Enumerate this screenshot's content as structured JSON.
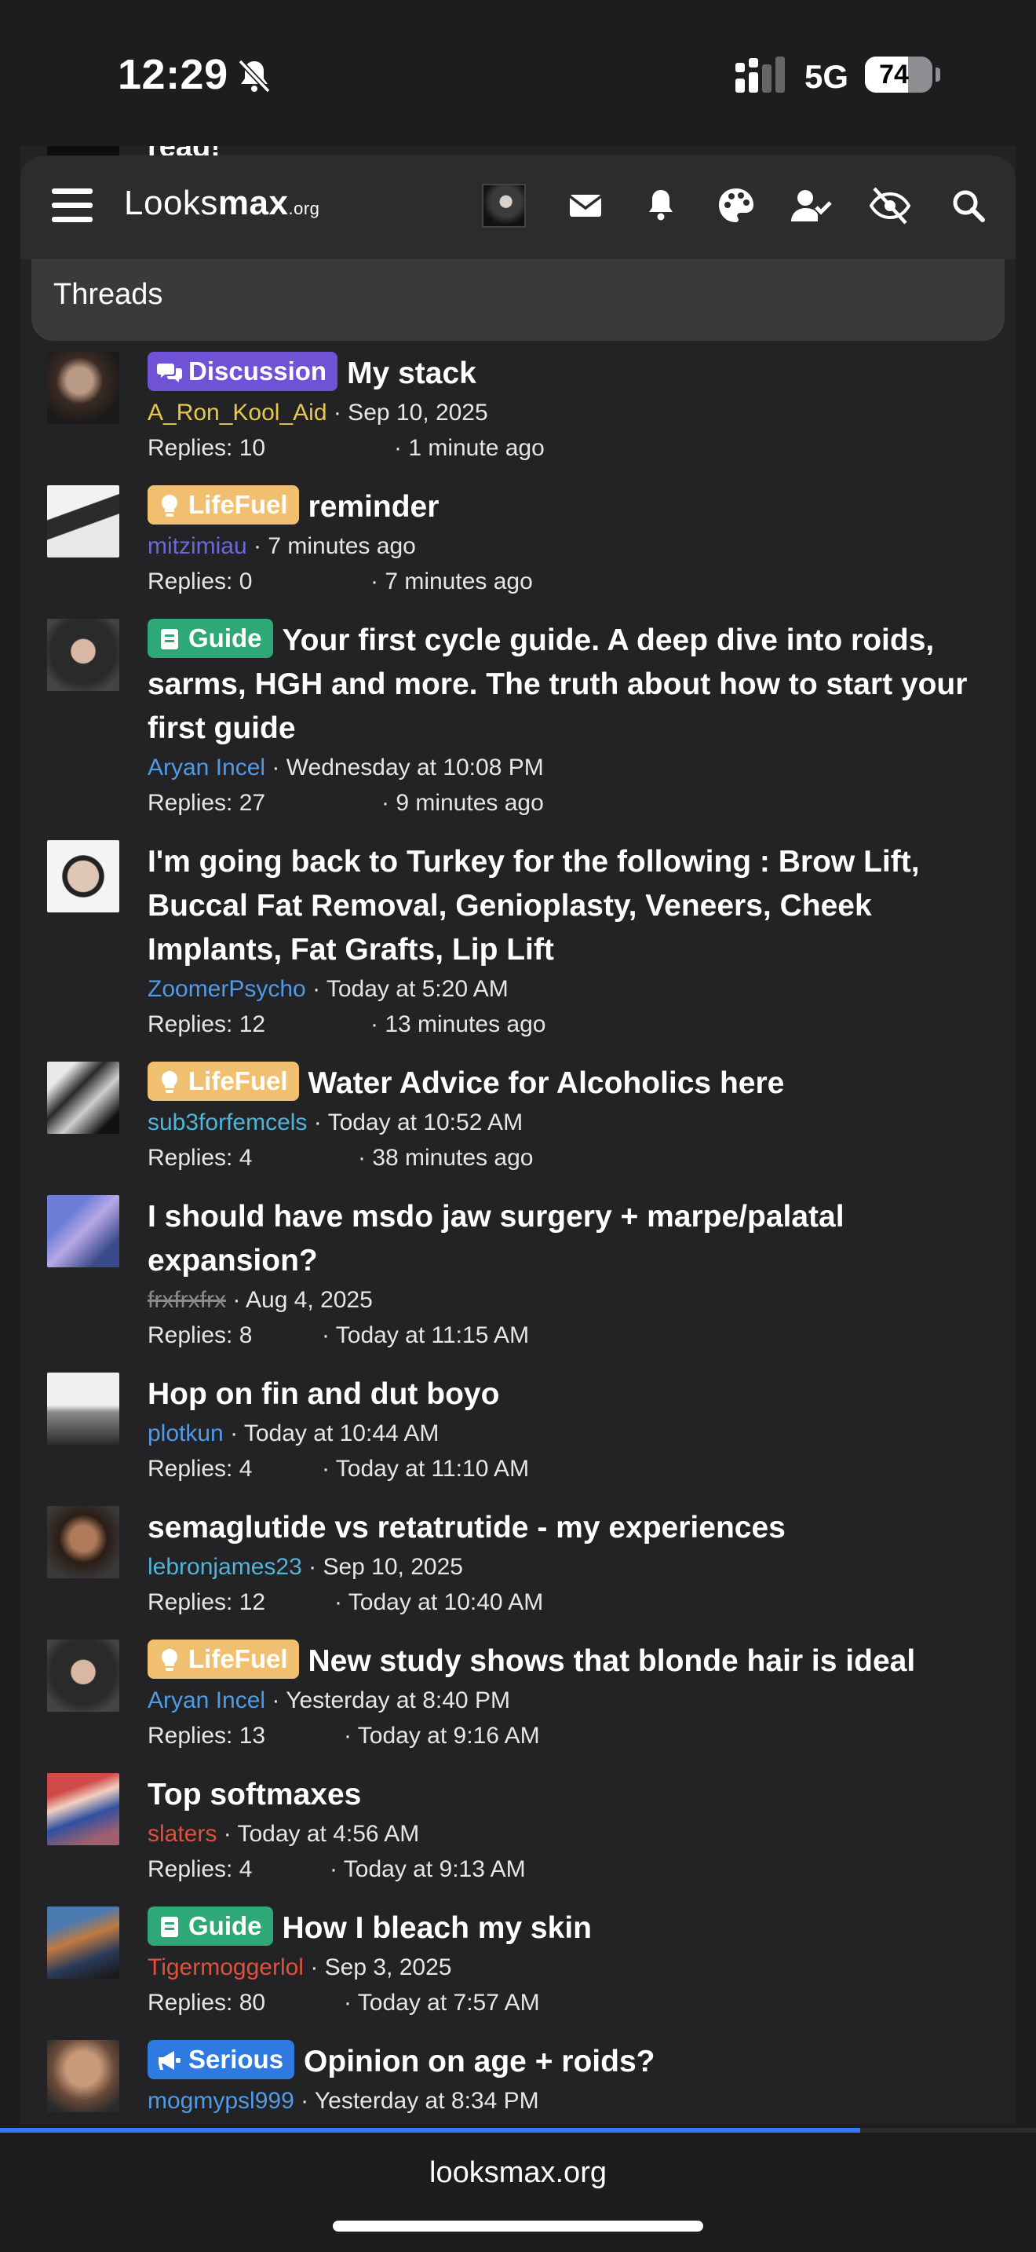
{
  "status": {
    "time": "12:29",
    "network": "5G",
    "battery": "74",
    "battery_level": 0.74
  },
  "fragment": {
    "text": "read!"
  },
  "nav": {
    "logo_main": "Looks",
    "logo_bold": "max",
    "logo_tld": ".org"
  },
  "section_title": "Threads",
  "threads": [
    {
      "badge": "Discussion",
      "title": "My stack",
      "author": "A_Ron_Kool_Aid",
      "date": "· Sep 10, 2025",
      "replies": "Replies: 10",
      "last": "· 1 minute ago"
    },
    {
      "badge": "LifeFuel",
      "title": "reminder",
      "author": "mitzimiau",
      "date": "· 7 minutes ago",
      "replies": "Replies: 0",
      "last": "· 7 minutes ago"
    },
    {
      "badge": "Guide",
      "title": "Your first cycle guide. A deep dive into roids, sarms, HGH and more. The truth about how to start your first guide",
      "author": "Aryan Incel",
      "date": "· Wednesday at 10:08 PM",
      "replies": "Replies: 27",
      "last": "· 9 minutes ago"
    },
    {
      "badge": "",
      "title": "I'm going back to Turkey for the following : Brow Lift, Buccal Fat Removal, Genioplasty, Veneers, Cheek Implants, Fat Grafts, Lip Lift",
      "author": "ZoomerPsycho",
      "date": "· Today at 5:20 AM",
      "replies": "Replies: 12",
      "last": "· 13 minutes ago"
    },
    {
      "badge": "LifeFuel",
      "title": "Water Advice for Alcoholics here",
      "author": "sub3forfemcels",
      "date": "· Today at 10:52 AM",
      "replies": "Replies: 4",
      "last": "· 38 minutes ago"
    },
    {
      "badge": "",
      "title": "I should have msdo jaw surgery + marpe/palatal expansion?",
      "author": "frxfrxfrx",
      "date": "· Aug 4, 2025",
      "replies": "Replies: 8",
      "last": "· Today at 11:15 AM"
    },
    {
      "badge": "",
      "title": "Hop on fin and dut boyo",
      "author": "plotkun",
      "date": "· Today at 10:44 AM",
      "replies": "Replies: 4",
      "last": "· Today at 11:10 AM"
    },
    {
      "badge": "",
      "title": "semaglutide vs retatrutide - my experiences",
      "author": "lebronjames23",
      "date": "· Sep 10, 2025",
      "replies": "Replies: 12",
      "last": "· Today at 10:40 AM"
    },
    {
      "badge": "LifeFuel",
      "title": "New study shows that blonde hair is ideal",
      "author": "Aryan Incel",
      "date": "· Yesterday at 8:40 PM",
      "replies": "Replies: 13",
      "last": "· Today at 9:16 AM"
    },
    {
      "badge": "",
      "title": "Top softmaxes",
      "author": "slaters",
      "date": "· Today at 4:56 AM",
      "replies": "Replies: 4",
      "last": "· Today at 9:13 AM"
    },
    {
      "badge": "Guide",
      "title": "How I bleach my skin",
      "author": "Tigermoggerlol",
      "date": "· Sep 3, 2025",
      "replies": "Replies: 80",
      "last": "· Today at 7:57 AM"
    },
    {
      "badge": "Serious",
      "title": "Opinion on age + roids?",
      "author": "mogmypsl999",
      "date": "· Yesterday at 8:34 PM",
      "replies": "",
      "last": ""
    }
  ],
  "colors": {
    "discussion": "#6f52d6",
    "lifefuel": "#f0c070",
    "guide": "#2fa877",
    "serious": "#2f7ae0",
    "progress": "#3478f6"
  },
  "page_load_progress": 0.83,
  "browser": {
    "url": "looksmax.org"
  }
}
